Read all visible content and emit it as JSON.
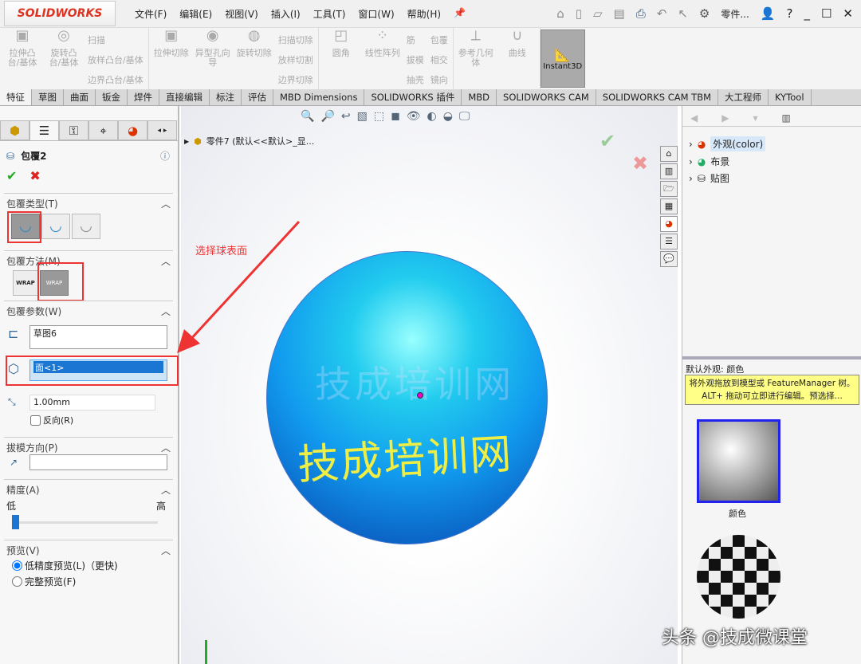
{
  "app": {
    "logo": "SOLIDWORKS"
  },
  "menu": [
    "文件(F)",
    "编辑(E)",
    "视图(V)",
    "插入(I)",
    "工具(T)",
    "窗口(W)",
    "帮助(H)"
  ],
  "quick": {
    "part_label": "零件...",
    "help": "?"
  },
  "ribbon": {
    "g1": {
      "extrude": "拉伸凸台/基体",
      "revolve": "旋转凸台/基体",
      "sweep": "扫描",
      "loft": "放样凸台/基体",
      "boundary": "边界凸台/基体"
    },
    "g2": {
      "cut_extrude": "拉伸切除",
      "hole": "异型孔向导",
      "cut_revolve": "旋转切除",
      "cut_sweep": "扫描切除",
      "cut_loft": "放样切割",
      "cut_boundary": "边界切除"
    },
    "g3": {
      "fillet": "圆角",
      "pattern": "线性阵列",
      "rib": "筋",
      "draft": "拔模",
      "shell": "抽壳",
      "wrap": "包覆",
      "intersect": "相交",
      "mirror": "镜向"
    },
    "g4": {
      "refgeom": "参考几何体",
      "curves": "曲线"
    },
    "instant3d": "Instant3D"
  },
  "tabs": [
    "特征",
    "草图",
    "曲面",
    "钣金",
    "焊件",
    "直接编辑",
    "标注",
    "评估",
    "MBD Dimensions",
    "SOLIDWORKS 插件",
    "MBD",
    "SOLIDWORKS CAM",
    "SOLIDWORKS CAM TBM",
    "大工程师",
    "KYTool"
  ],
  "property": {
    "title": "包覆2",
    "type_section": "包覆类型(T)",
    "method_section": "包覆方法(M)",
    "params_section": "包覆参数(W)",
    "sketch_value": "草图6",
    "face_value": "面<1>",
    "thickness": "1.00mm",
    "reverse": "反向(R)",
    "pull_section": "拔模方向(P)",
    "accuracy_section": "精度(A)",
    "low": "低",
    "high": "高",
    "accuracy_value": 0.0,
    "preview_section": "预览(V)",
    "preview_low": "低精度预览(L)（更快)",
    "preview_full": "完整预览(F)"
  },
  "viewport": {
    "tree_item": "零件7 (默认<<默认>_显...",
    "annotation": "选择球表面",
    "text_on_sphere": "技成培训网"
  },
  "taskpane": {
    "items": [
      "外观(color)",
      "布景",
      "贴图"
    ],
    "default_label": "默认外观: 颜色",
    "tooltip": "将外观拖放到模型或 FeatureManager 树。ALT+ 拖动可立即进行编辑。预选择...",
    "swatch_label": "颜色"
  },
  "watermark": "头条 @技成微课堂"
}
